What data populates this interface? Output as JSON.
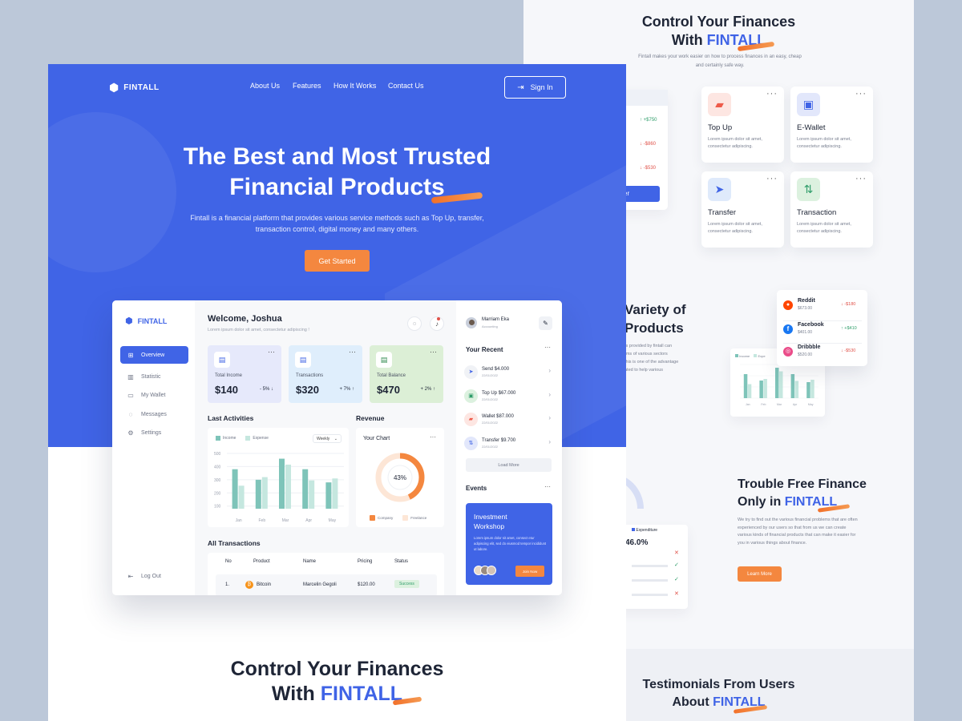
{
  "right_page": {
    "top_title_line1": "Control Your Finances",
    "top_title_line2_prefix": "With",
    "brand_accent": "FINTALL",
    "top_desc": "Fintall makes your work easier on how to process finances in an easy, cheap and certainly safe way.",
    "partial_amounts": [
      "+$750",
      "-$860",
      "-$530"
    ],
    "partial_button": "er",
    "features": [
      {
        "title": "Top Up",
        "desc": "Lorem ipsum dolor sit amet, consectetur adipiscing.",
        "icon": "wallet-red-icon",
        "color": "#ee5b4a"
      },
      {
        "title": "E-Wallet",
        "desc": "Lorem ipsum dolor sit amet, consectetur adipiscing.",
        "icon": "ewallet-icon",
        "color": "#3f63e6"
      },
      {
        "title": "Transfer",
        "desc": "Lorem ipsum dolor sit amet, consectetur adipiscing.",
        "icon": "send-icon",
        "color": "#3f63e6"
      },
      {
        "title": "Transaction",
        "desc": "Lorem ipsum dolor sit amet, consectetur adipiscing.",
        "icon": "transaction-icon",
        "color": "#2f9d6a"
      }
    ],
    "feature_more": "···",
    "variety_line1": "Variety of",
    "variety_line2": "Products",
    "variety_desc": [
      "ts provided by fintall can",
      "rms of various sectors",
      "this is one of the advantage",
      "ated to help various"
    ],
    "social": [
      {
        "name": "Reddit",
        "amount": "$673.00",
        "change": "-$180",
        "dir": "down"
      },
      {
        "name": "Facebook",
        "amount": "$401.00",
        "change": "+$410",
        "dir": "up"
      },
      {
        "name": "Dribbble",
        "amount": "$520.00",
        "change": "-$530",
        "dir": "down"
      }
    ],
    "mini_chart_legend": [
      "Income",
      "Expe"
    ],
    "mini_chart_months": [
      "Jan",
      "Feb",
      "Mar",
      "Apr",
      "May"
    ],
    "trouble_line1": "Trouble Free Finance",
    "trouble_line2_prefix": "Only in",
    "trouble_desc": "We try to find out the various financial problems that are often experienced by our users so that from us we can create various kinds of financial products that can make it easier for you in various things about finance.",
    "learn_more": "Learn More",
    "expenditure_label": "Expenditure",
    "expenditure_value": "46.0%",
    "testimonials_line1": "Testimonials From Users",
    "testimonials_line2_prefix": "About"
  },
  "main": {
    "brand": "FINTALL",
    "nav": [
      "About Us",
      "Features",
      "How It Works",
      "Contact Us"
    ],
    "sign_in": "Sign In",
    "hero_title_line1": "The Best and Most Trusted",
    "hero_title_line2": "Financial Products",
    "hero_desc_line1": "Fintall is a financial platform that provides various service methods such as Top Up, transfer,",
    "hero_desc_line2": "transaction control, digital money and many others.",
    "get_started": "Get Started",
    "bottom_title_line1": "Control Your Finances",
    "bottom_title_line2_prefix": "With",
    "bottom_brand": "FINTALL"
  },
  "dashboard": {
    "brand": "FINTALL",
    "sidebar": [
      {
        "label": "Overview",
        "icon": "grid-icon",
        "active": true
      },
      {
        "label": "Statistic",
        "icon": "chart-icon"
      },
      {
        "label": "My Wallet",
        "icon": "wallet-icon"
      },
      {
        "label": "Messages",
        "icon": "message-icon"
      },
      {
        "label": "Settings",
        "icon": "settings-icon"
      }
    ],
    "logout": "Log Out",
    "welcome": "Welcome, Joshua",
    "welcome_sub": "Lorem ipsum dolor sit amet, consectetur adipiscing !",
    "stats": [
      {
        "label": "Total Income",
        "value": "$140",
        "change": "- 5%",
        "dir": "down",
        "bg": "#e6e9fb"
      },
      {
        "label": "Transactions",
        "value": "$320",
        "change": "+ 7%",
        "dir": "up",
        "bg": "#dfeefc"
      },
      {
        "label": "Total Balance",
        "value": "$470",
        "change": "+ 2%",
        "dir": "up",
        "bg": "#dcefd6"
      }
    ],
    "last_activities": "Last Activities",
    "legend_income": "Income",
    "legend_expense": "Expense",
    "period": "Weekly",
    "revenue": "Revenue",
    "your_chart": "Your Chart",
    "donut_value": "43%",
    "donut_percent": 43,
    "donut_legend": [
      "Company",
      "Freelance"
    ],
    "all_transactions": "All Transactions",
    "table_headers": [
      "No",
      "Product",
      "Name",
      "Pricing",
      "Status"
    ],
    "table_row": {
      "no": "1.",
      "product": "Bitcoin",
      "name": "Marcelin Gegoli",
      "pricing": "$120.00",
      "status": "Success"
    },
    "profile_name": "Marriam Eka",
    "profile_role": "Accounting",
    "your_recent": "Your Recent",
    "recent": [
      {
        "label": "Send $4.000",
        "date": "22/01/2022",
        "icon": "send-icon"
      },
      {
        "label": "Top Up $67.000",
        "date": "22/01/2022",
        "icon": "topup-icon"
      },
      {
        "label": "Wallet $87.000",
        "date": "22/01/2022",
        "icon": "wallet-icon"
      },
      {
        "label": "Transfer $9.700",
        "date": "22/01/2022",
        "icon": "transfer-icon"
      }
    ],
    "load_more": "Load More",
    "events": "Events",
    "event_title_line1": "Investment",
    "event_title_line2": "Workshop",
    "event_desc": "Lorem ipsum dolor sit amet, consect etur adipiscing elit, sed do eiusmod tempor incididunt ut labore.",
    "join_now": "Join Now",
    "colors": {
      "primary": "#4064e6",
      "orange": "#f4873f",
      "teal": "#7ec4b9",
      "teal_light": "#c5e7df"
    }
  },
  "chart_data": [
    {
      "type": "bar",
      "title": "Last Activities",
      "categories": [
        "Jan",
        "Feb",
        "Mar",
        "Apr",
        "May"
      ],
      "series": [
        {
          "name": "Income",
          "values": [
            380,
            300,
            460,
            380,
            280
          ]
        },
        {
          "name": "Expense",
          "values": [
            255,
            320,
            415,
            295,
            310
          ]
        }
      ],
      "yticks": [
        500,
        400,
        300,
        200,
        100
      ],
      "ylim": [
        80,
        500
      ],
      "grid": true,
      "legend": "top-left"
    },
    {
      "type": "pie",
      "title": "Your Chart",
      "categories": [
        "Company",
        "Freelance"
      ],
      "values": [
        43,
        57
      ]
    }
  ]
}
